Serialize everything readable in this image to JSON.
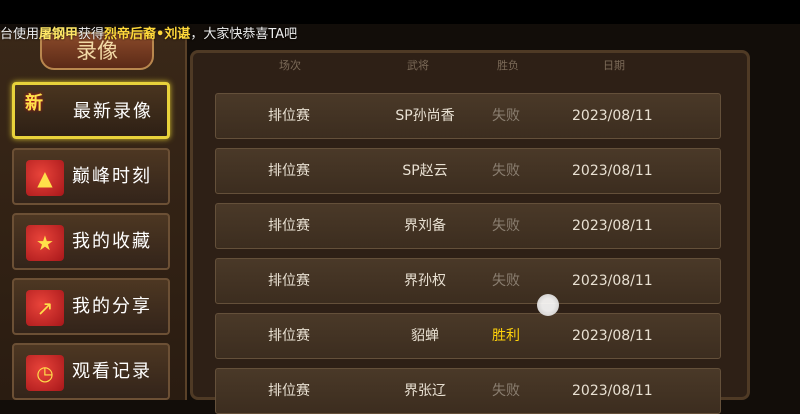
{
  "ticker": {
    "prefix": "台使用",
    "item": "屠钢甲",
    "mid": "获得",
    "reward": "烈帝后裔•刘谌",
    "suffix": "，大家快恭喜TA吧"
  },
  "left_panel": {
    "title": "录像",
    "nav": [
      {
        "label": "最新录像",
        "badge": "新",
        "icon": "new-ribbon-icon"
      },
      {
        "label": "巅峰时刻",
        "icon": "envelope-arrow-icon"
      },
      {
        "label": "我的收藏",
        "icon": "envelope-star-icon"
      },
      {
        "label": "我的分享",
        "icon": "envelope-share-icon"
      },
      {
        "label": "观看记录",
        "icon": "envelope-clock-icon"
      }
    ]
  },
  "table": {
    "headers": [
      "场次",
      "武将",
      "胜负",
      "日期"
    ],
    "rows": [
      {
        "mode": "排位赛",
        "general": "SP孙尚香",
        "result": "失败",
        "date": "2023/08/11"
      },
      {
        "mode": "排位赛",
        "general": "SP赵云",
        "result": "失败",
        "date": "2023/08/11"
      },
      {
        "mode": "排位赛",
        "general": "界刘备",
        "result": "失败",
        "date": "2023/08/11"
      },
      {
        "mode": "排位赛",
        "general": "界孙权",
        "result": "失败",
        "date": "2023/08/11"
      },
      {
        "mode": "排位赛",
        "general": "貂蝉",
        "result": "胜利",
        "date": "2023/08/11"
      },
      {
        "mode": "排位赛",
        "general": "界张辽",
        "result": "失败",
        "date": "2023/08/11"
      }
    ]
  },
  "colors": {
    "win": "#ffd20a",
    "lose": "#8a7e70",
    "active_border": "#e8d23b"
  }
}
